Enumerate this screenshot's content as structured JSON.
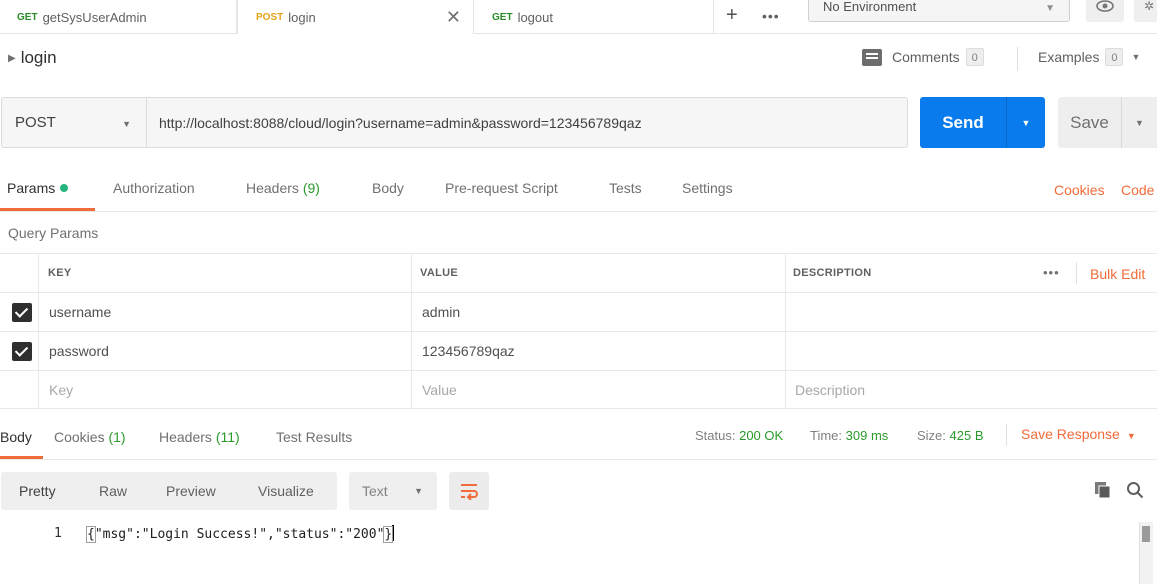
{
  "tabs": [
    {
      "method": "GET",
      "name": "getSysUserAdmin"
    },
    {
      "method": "POST",
      "name": "login"
    },
    {
      "method": "GET",
      "name": "logout"
    }
  ],
  "environment": {
    "selected": "No Environment"
  },
  "request": {
    "name": "login",
    "comments_label": "Comments",
    "comments_count": "0",
    "examples_label": "Examples",
    "examples_count": "0",
    "method": "POST",
    "url": "http://localhost:8088/cloud/login?username=admin&password=123456789qaz",
    "send_label": "Send",
    "save_label": "Save"
  },
  "request_tabs": {
    "params": "Params",
    "authorization": "Authorization",
    "headers": "Headers",
    "headers_count": "(9)",
    "body": "Body",
    "prerequest": "Pre-request Script",
    "tests": "Tests",
    "settings": "Settings",
    "cookies_link": "Cookies",
    "code_link": "Code"
  },
  "query_params": {
    "label": "Query Params",
    "headers": {
      "key": "KEY",
      "value": "VALUE",
      "description": "DESCRIPTION"
    },
    "bulk_edit": "Bulk Edit",
    "rows": [
      {
        "key": "username",
        "value": "admin",
        "description": "",
        "checked": true
      },
      {
        "key": "password",
        "value": "123456789qaz",
        "description": "",
        "checked": true
      }
    ],
    "placeholders": {
      "key": "Key",
      "value": "Value",
      "description": "Description"
    }
  },
  "response": {
    "tabs": {
      "body": "Body",
      "cookies": "Cookies",
      "cookies_count": "(1)",
      "headers": "Headers",
      "headers_count": "(11)",
      "test_results": "Test Results"
    },
    "status_label": "Status:",
    "status_value": "200 OK",
    "time_label": "Time:",
    "time_value": "309 ms",
    "size_label": "Size:",
    "size_value": "425 B",
    "save_response": "Save Response",
    "formats": {
      "pretty": "Pretty",
      "raw": "Raw",
      "preview": "Preview",
      "visualize": "Visualize"
    },
    "type_select": "Text",
    "line_number": "1",
    "body_text": "\"msg\":\"Login Success!\",\"status\":\"200\""
  },
  "colors": {
    "accent": "#f26b3a",
    "send": "#097bed",
    "success": "#2a9b2a",
    "post_method": "#e8a317",
    "get_method": "#2a8c2a"
  },
  "icons": [
    "close-icon",
    "plus-icon",
    "more-icon",
    "eye-icon",
    "settings-icon",
    "comment-icon",
    "chevron-down-icon",
    "checkbox-checked-icon",
    "wrap-lines-icon",
    "copy-icon",
    "search-icon"
  ]
}
